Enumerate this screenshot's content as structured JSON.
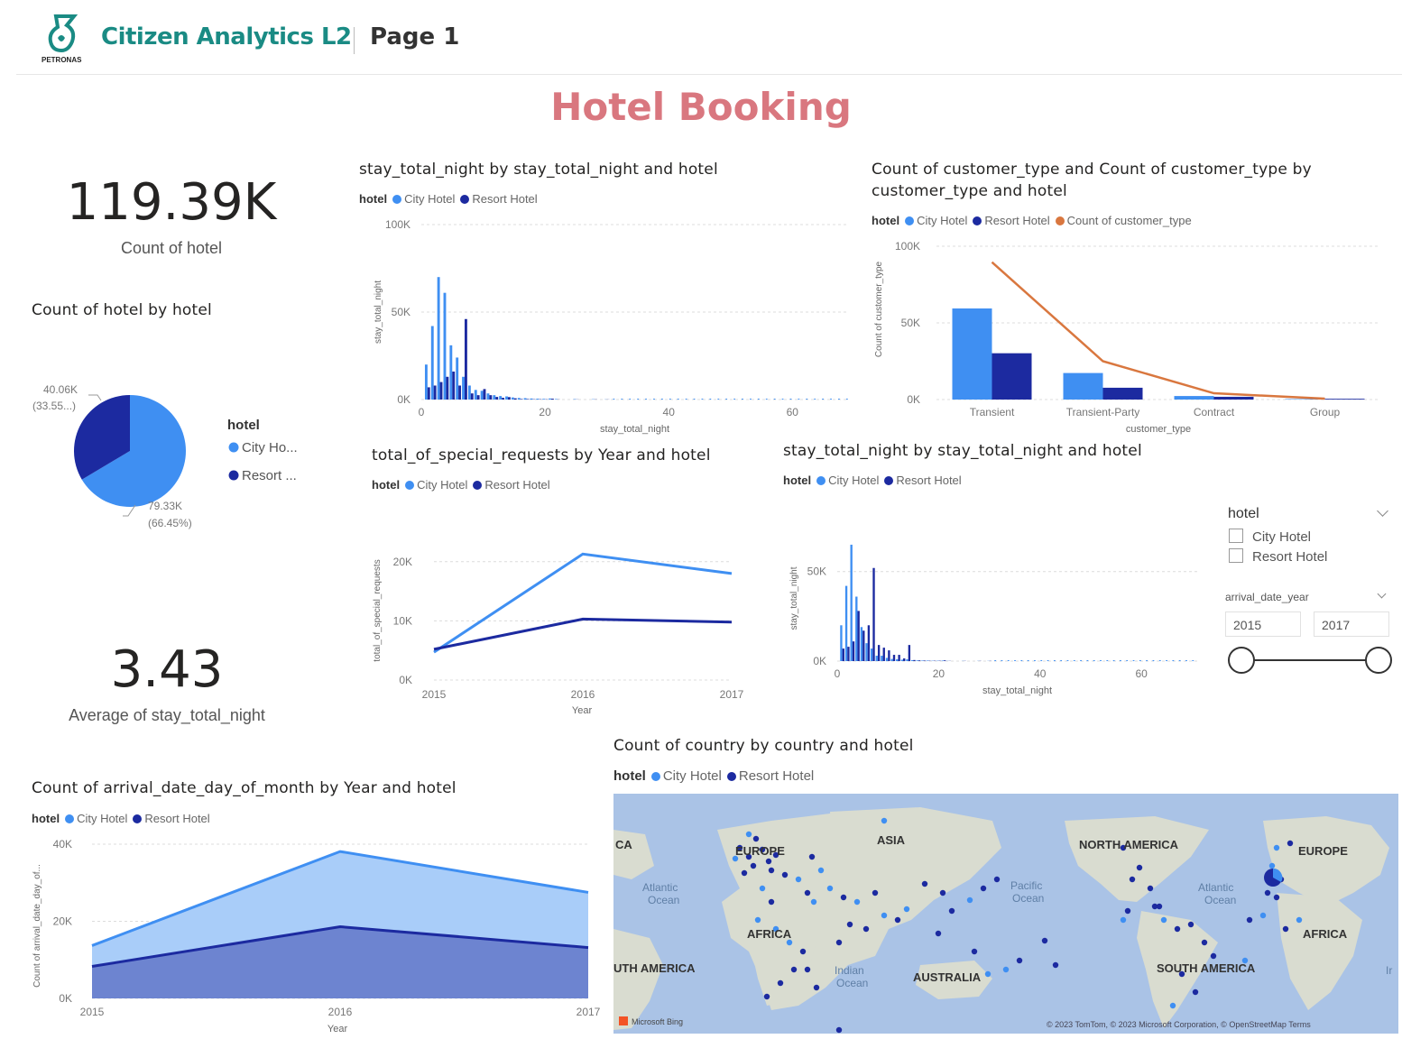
{
  "header": {
    "app_title": "Citizen Analytics L2",
    "page_name": "Page 1",
    "logo_text": "PETRONAS"
  },
  "report_title": "Hotel Booking",
  "colors": {
    "city": "#3f8ff2",
    "resort": "#1c2aa0",
    "count_line": "#d9773f",
    "title": "#d9777f",
    "brand": "#1a8b84"
  },
  "kpis": {
    "count_hotel": {
      "value": "119.39K",
      "label": "Count of hotel"
    },
    "avg_stay": {
      "value": "3.43",
      "label": "Average of stay_total_night"
    }
  },
  "legend": {
    "title": "hotel",
    "city": "City Hotel",
    "resort": "Resort Hotel",
    "count_customer_type": "Count of customer_type"
  },
  "pie": {
    "title": "Count of hotel by hotel",
    "legend_title": "hotel",
    "legend_city": "City Ho...",
    "legend_resort": "Resort ...",
    "label_resort_value": "40.06K",
    "label_resort_pct": "(33.55...)",
    "label_city_value": "79.33K",
    "label_city_pct": "(66.45%)"
  },
  "slicer": {
    "hotel_title": "hotel",
    "options": [
      "City Hotel",
      "Resort Hotel"
    ],
    "year_title": "arrival_date_year",
    "year_from": "2015",
    "year_to": "2017"
  },
  "map": {
    "title": "Count of country by country and hotel",
    "labels": {
      "ca": "CA",
      "europe_left": "EUROPE",
      "asia": "ASIA",
      "north_america": "NORTH AMERICA",
      "europe_right": "EUROPE",
      "atlantic_left": "Atlantic",
      "atlantic_left2": "Ocean",
      "pacific": "Pacific",
      "pacific2": "Ocean",
      "atlantic_right": "Atlantic",
      "atlantic_right2": "Ocean",
      "africa_left": "AFRICA",
      "africa_right": "AFRICA",
      "south_america_left": "UTH AMERICA",
      "indian": "Indian",
      "indian2": "Ocean",
      "australia": "AUSTRALIA",
      "south_america_right": "SOUTH AMERICA",
      "edge_i": "Ir",
      "bing": "Microsoft Bing",
      "copyright": "© 2023 TomTom, © 2023 Microsoft Corporation, © OpenStreetMap  Terms"
    }
  },
  "chart_data": [
    {
      "id": "hist1",
      "type": "bar",
      "title": "stay_total_night by stay_total_night and hotel",
      "xlabel": "stay_total_night",
      "ylabel": "stay_total_night",
      "xlim": [
        0,
        69
      ],
      "ylim": [
        0,
        100000
      ],
      "xticks": [
        "0",
        "20",
        "40",
        "60"
      ],
      "yticks": [
        "0K",
        "50K",
        "100K"
      ],
      "x": [
        1,
        2,
        3,
        4,
        5,
        6,
        7,
        8,
        9,
        10,
        11,
        12,
        13,
        14,
        15,
        16,
        17,
        18,
        19,
        20,
        21,
        22,
        25,
        28,
        30
      ],
      "series": [
        {
          "name": "City Hotel",
          "values": [
            20000,
            42000,
            70000,
            61000,
            31000,
            24000,
            13000,
            8000,
            5500,
            5000,
            3500,
            2500,
            2000,
            1800,
            1200,
            900,
            800,
            600,
            500,
            400,
            600,
            300,
            250,
            200,
            100
          ]
        },
        {
          "name": "Resort Hotel",
          "values": [
            7000,
            8000,
            10000,
            13000,
            16000,
            8000,
            46000,
            3500,
            2500,
            6000,
            2500,
            1500,
            1000,
            1400,
            700,
            300,
            300,
            200,
            200,
            150,
            500,
            100,
            100,
            100,
            80
          ]
        }
      ]
    },
    {
      "id": "custtype",
      "type": "bar",
      "title": "Count of customer_type and Count of customer_type by customer_type and hotel",
      "xlabel": "customer_type",
      "ylabel": "Count of customer_type",
      "ylim": [
        0,
        100000
      ],
      "yticks": [
        "0K",
        "50K",
        "100K"
      ],
      "categories": [
        "Transient",
        "Transient-Party",
        "Contract",
        "Group"
      ],
      "series": [
        {
          "name": "City Hotel",
          "values": [
            59400,
            17300,
            2300,
            300
          ]
        },
        {
          "name": "Resort Hotel",
          "values": [
            30200,
            7700,
            1800,
            500
          ]
        },
        {
          "name": "Count of customer_type",
          "values": [
            89600,
            25000,
            4100,
            600
          ]
        }
      ]
    },
    {
      "id": "requests",
      "type": "line",
      "title": "total_of_special_requests by Year and hotel",
      "xlabel": "Year",
      "ylabel": "total_of_special_requests",
      "categories": [
        "2015",
        "2016",
        "2017"
      ],
      "ylim": [
        0,
        25000
      ],
      "yticks": [
        "0K",
        "10K",
        "20K"
      ],
      "series": [
        {
          "name": "City Hotel",
          "values": [
            4700,
            21300,
            18000
          ]
        },
        {
          "name": "Resort Hotel",
          "values": [
            5200,
            10300,
            9800
          ]
        }
      ]
    },
    {
      "id": "hist2",
      "type": "bar",
      "title": "stay_total_night by stay_total_night and hotel",
      "xlabel": "stay_total_night",
      "ylabel": "stay_total_night",
      "xlim": [
        0,
        71
      ],
      "ylim": [
        0,
        70000
      ],
      "xticks": [
        "0",
        "20",
        "40",
        "60"
      ],
      "yticks": [
        "0K",
        "50K"
      ],
      "x": [
        1,
        2,
        3,
        4,
        5,
        6,
        7,
        8,
        9,
        10,
        11,
        12,
        13,
        14,
        15,
        16,
        17,
        18,
        19,
        20,
        21,
        22,
        25,
        28,
        30
      ],
      "series": [
        {
          "name": "City Hotel",
          "values": [
            20000,
            42000,
            65000,
            36000,
            19000,
            10000,
            7000,
            3000,
            3000,
            1800,
            1200,
            1000,
            800,
            1000,
            500,
            400,
            300,
            300,
            200,
            200,
            300,
            100,
            100,
            100,
            100
          ]
        },
        {
          "name": "Resort Hotel",
          "values": [
            7000,
            8000,
            11000,
            28000,
            17000,
            20000,
            52000,
            9000,
            7500,
            6000,
            3500,
            3500,
            1500,
            9000,
            600,
            400,
            300,
            200,
            200,
            200,
            400,
            100,
            100,
            100,
            100
          ]
        }
      ]
    },
    {
      "id": "area",
      "type": "area",
      "title": "Count of arrival_date_day_of_month by Year and hotel",
      "xlabel": "Year",
      "ylabel": "Count of arrival_date_day_of...",
      "categories": [
        "2015",
        "2016",
        "2017"
      ],
      "ylim": [
        0,
        40000
      ],
      "yticks": [
        "0K",
        "20K",
        "40K"
      ],
      "series": [
        {
          "name": "City Hotel",
          "values": [
            13700,
            38100,
            27500
          ]
        },
        {
          "name": "Resort Hotel",
          "values": [
            8300,
            18600,
            13200
          ]
        }
      ]
    }
  ]
}
